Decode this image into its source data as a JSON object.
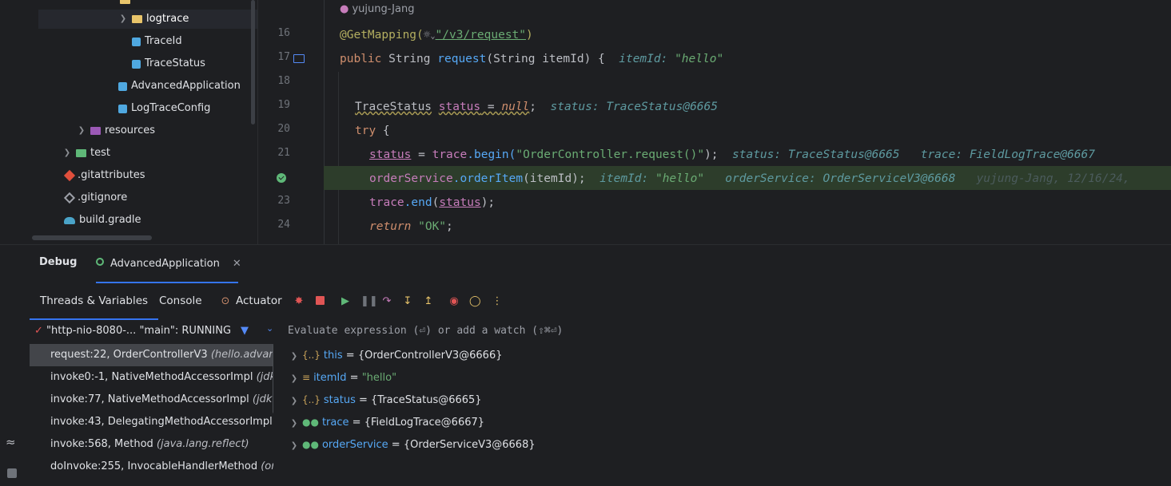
{
  "project_tree": {
    "items": [
      {
        "label": "logtrace",
        "icon": "folder-icon",
        "expanded": false
      },
      {
        "label": "TraceId",
        "icon": "class-icon"
      },
      {
        "label": "TraceStatus",
        "icon": "class-icon"
      },
      {
        "label": "AdvancedApplication",
        "icon": "spring-class-icon"
      },
      {
        "label": "LogTraceConfig",
        "icon": "class-icon"
      },
      {
        "label": "resources",
        "icon": "resources-folder-icon"
      },
      {
        "label": "test",
        "icon": "test-folder-icon"
      },
      {
        "label": ".gitattributes",
        "icon": "git-icon"
      },
      {
        "label": ".gitignore",
        "icon": "gitignore-icon"
      },
      {
        "label": "build.gradle",
        "icon": "gradle-icon"
      }
    ]
  },
  "editor": {
    "author_hint": "yujung-Jang",
    "line_numbers": [
      "16",
      "17",
      "18",
      "19",
      "20",
      "21",
      "23",
      "24"
    ],
    "lines": {
      "l16": {
        "annotation": "@GetMapping(",
        "path": "\"/v3/request\"",
        "close": ")"
      },
      "l17": {
        "kw": "public",
        "type": "String",
        "name": "request",
        "params": "(String itemId) {",
        "hint_name": "itemId:",
        "hint_val": "\"hello\""
      },
      "l19": {
        "type": "TraceStatus",
        "var": "status",
        "eq": " = ",
        "nullkw": "null",
        "semi": ";",
        "hint": "status: TraceStatus@6665"
      },
      "l20": {
        "kw": "try",
        "brace": " {"
      },
      "l21": {
        "var": "status",
        "eq": " = ",
        "field": "trace",
        "call": ".begin(",
        "arg": "\"OrderController.request()\"",
        "end": ");",
        "hint1": "status: TraceStatus@6665",
        "hint2": "trace: FieldLogTrace@6667"
      },
      "l22": {
        "field": "orderService",
        "call": ".orderItem",
        "args": "(itemId);",
        "hint1_name": "itemId:",
        "hint1_val": "\"hello\"",
        "hint2": "orderService: OrderServiceV3@6668",
        "blame": "yujung-Jang, 12/16/24,"
      },
      "l23": {
        "field": "trace",
        "call": ".end",
        "open": "(",
        "var": "status",
        "close": ");"
      },
      "l24": {
        "kw": "return",
        "val": " \"OK\"",
        "semi": ";"
      }
    }
  },
  "debug": {
    "title": "Debug",
    "session_tab": "AdvancedApplication",
    "subtabs": [
      "Threads & Variables",
      "Console",
      "Actuator"
    ],
    "thread_selector": "\"http-nio-8080-... \"main\": RUNNING",
    "eval_placeholder": "Evaluate expression (⏎) or add a watch (⇧⌘⏎)",
    "frames": [
      {
        "method": "request:22, OrderControllerV3",
        "pkg": "(hello.advanc"
      },
      {
        "method": "invoke0:-1, NativeMethodAccessorImpl",
        "pkg": "(jdk.i"
      },
      {
        "method": "invoke:77, NativeMethodAccessorImpl",
        "pkg": "(jdk.in"
      },
      {
        "method": "invoke:43, DelegatingMethodAccessorImpl",
        "pkg": "(j"
      },
      {
        "method": "invoke:568, Method",
        "pkg": "(java.lang.reflect)"
      },
      {
        "method": "doInvoke:255, InvocableHandlerMethod",
        "pkg": "(org"
      }
    ],
    "variables": [
      {
        "name": "this",
        "value": "{OrderControllerV3@6666}",
        "icon": "object-icon"
      },
      {
        "name": "itemId",
        "value": "\"hello\"",
        "icon": "field-icon"
      },
      {
        "name": "status",
        "value": "{TraceStatus@6665}",
        "icon": "object-icon"
      },
      {
        "name": "trace",
        "value": "{FieldLogTrace@6667}",
        "icon": "watch-glasses-icon"
      },
      {
        "name": "orderService",
        "value": "{OrderServiceV3@6668}",
        "icon": "watch-glasses-icon"
      }
    ]
  }
}
